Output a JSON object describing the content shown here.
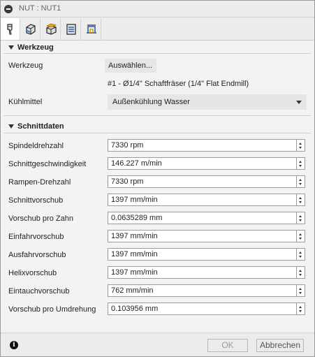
{
  "window": {
    "title": "NUT : NUT1"
  },
  "toolbar": {
    "tabs": [
      {
        "name": "tool-tab-icon"
      },
      {
        "name": "geometry-tab-icon"
      },
      {
        "name": "heights-tab-icon"
      },
      {
        "name": "passes-tab-icon"
      },
      {
        "name": "linking-tab-icon"
      }
    ]
  },
  "werkzeug": {
    "section_title": "Werkzeug",
    "tool_label": "Werkzeug",
    "select_button": "Auswählen...",
    "tool_info": "#1 - Ø1/4\" Schaftfräser (1/4\" Flat Endmill)",
    "coolant_label": "Kühlmittel",
    "coolant_value": "Außenkühlung Wasser"
  },
  "schnittdaten": {
    "section_title": "Schnittdaten",
    "fields": [
      {
        "label": "Spindeldrehzahl",
        "value": "7330 rpm"
      },
      {
        "label": "Schnittgeschwindigkeit",
        "value": "146.227 m/min"
      },
      {
        "label": "Rampen-Drehzahl",
        "value": "7330 rpm"
      },
      {
        "label": "Schnittvorschub",
        "value": "1397 mm/min"
      },
      {
        "label": "Vorschub pro Zahn",
        "value": "0.0635289 mm"
      },
      {
        "label": "Einfahrvorschub",
        "value": "1397 mm/min"
      },
      {
        "label": "Ausfahrvorschub",
        "value": "1397 mm/min"
      },
      {
        "label": "Helixvorschub",
        "value": "1397 mm/min"
      },
      {
        "label": "Eintauchvorschub",
        "value": "762 mm/min"
      },
      {
        "label": "Vorschub pro Umdrehung",
        "value": "0.103956 mm"
      }
    ]
  },
  "footer": {
    "info_icon": "i",
    "ok_label": "OK",
    "cancel_label": "Abbrechen"
  },
  "colors": {
    "active_tab_bg": "#ffffff",
    "panel_bg": "#f3f3f3",
    "disabled_text": "#999999"
  }
}
